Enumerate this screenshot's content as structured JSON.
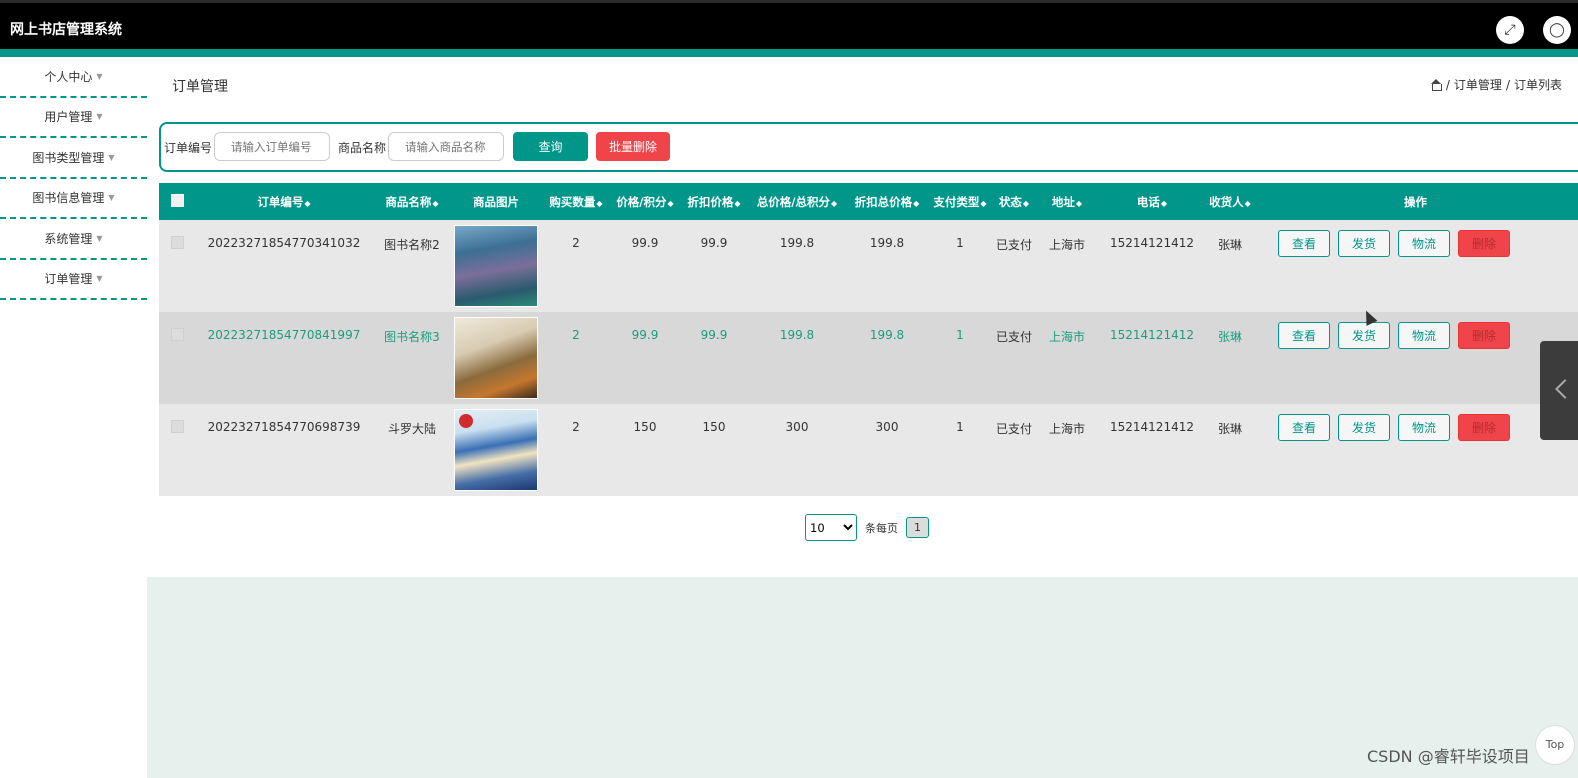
{
  "app": {
    "title": "网上书店管理系统"
  },
  "colors": {
    "accent": "#00968a",
    "danger": "#f0444b",
    "header_bg": "#000000"
  },
  "topbar": {
    "fullscreen_icon": "expand-icon",
    "user_icon": "user-icon"
  },
  "sidebar": {
    "items": [
      {
        "label": "个人中心"
      },
      {
        "label": "用户管理"
      },
      {
        "label": "图书类型管理"
      },
      {
        "label": "图书信息管理"
      },
      {
        "label": "系统管理"
      },
      {
        "label": "订单管理"
      }
    ]
  },
  "page": {
    "title": "订单管理",
    "breadcrumb": [
      "订单管理",
      "订单列表"
    ]
  },
  "search": {
    "order_no_label": "订单编号",
    "order_no_placeholder": "请输入订单编号",
    "product_name_label": "商品名称",
    "product_name_placeholder": "请输入商品名称",
    "query_label": "查询",
    "batch_delete_label": "批量删除"
  },
  "table": {
    "columns": [
      "订单编号",
      "商品名称",
      "商品图片",
      "购买数量",
      "价格/积分",
      "折扣价格",
      "总价格/总积分",
      "折扣总价格",
      "支付类型",
      "状态",
      "地址",
      "电话",
      "收货人",
      "操作"
    ],
    "actions": {
      "view": "查看",
      "ship": "发货",
      "logistics": "物流",
      "delete": "删除"
    },
    "rows": [
      {
        "order_no": "20223271854770341032",
        "product": "图书名称2",
        "qty": "2",
        "price": "99.9",
        "discount_price": "99.9",
        "total": "199.8",
        "discount_total": "199.8",
        "pay_type": "1",
        "status": "已支付",
        "address": "上海市",
        "phone": "15214121412",
        "receiver": "张琳"
      },
      {
        "order_no": "20223271854770841997",
        "product": "图书名称3",
        "qty": "2",
        "price": "99.9",
        "discount_price": "99.9",
        "total": "199.8",
        "discount_total": "199.8",
        "pay_type": "1",
        "status": "已支付",
        "address": "上海市",
        "phone": "15214121412",
        "receiver": "张琳"
      },
      {
        "order_no": "20223271854770698739",
        "product": "斗罗大陆",
        "qty": "2",
        "price": "150",
        "discount_price": "150",
        "total": "300",
        "discount_total": "300",
        "pay_type": "1",
        "status": "已支付",
        "address": "上海市",
        "phone": "15214121412",
        "receiver": "张琳"
      }
    ]
  },
  "pager": {
    "page_size": "10",
    "per_page_label": "条每页",
    "current_page": "1"
  },
  "misc": {
    "top_label": "Top",
    "watermark": "CSDN @睿轩毕设项目"
  }
}
